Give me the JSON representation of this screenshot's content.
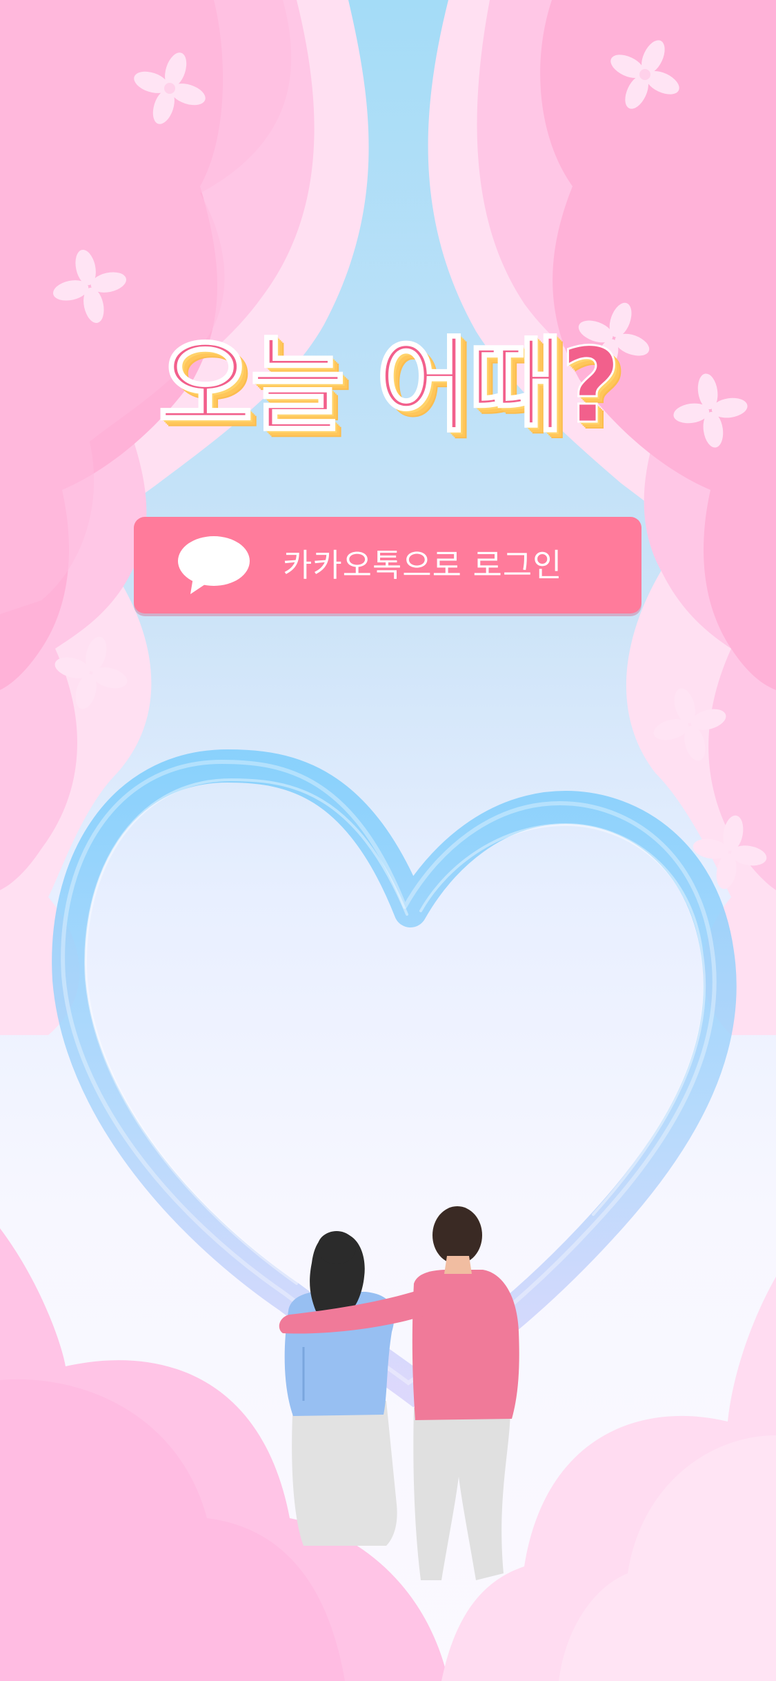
{
  "headline": "오늘 어때?",
  "login": {
    "label": "카카오톡으로 로그인",
    "icon": "speech-bubble-icon"
  },
  "colors": {
    "headline": "#f2608c",
    "headline_shadow": "#ffc65a",
    "button": "#ff7b9b",
    "curtain": "#ffb6da",
    "heart": "#8fd0fb"
  }
}
